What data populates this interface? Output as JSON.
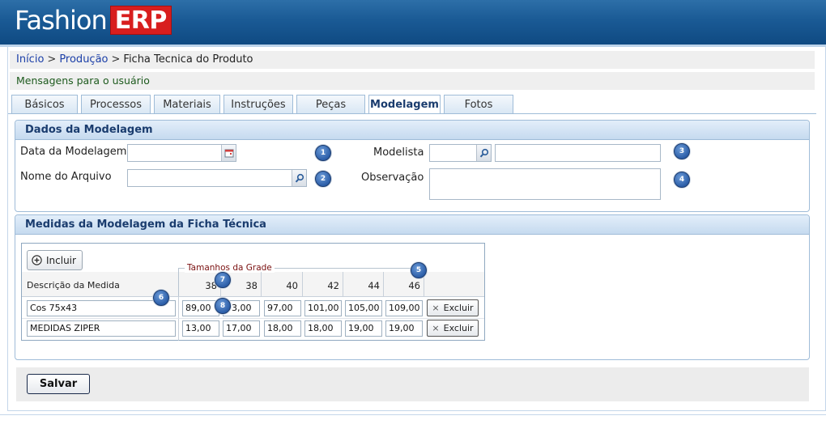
{
  "app": {
    "logo_text": "Fashion",
    "logo_badge": "ERP"
  },
  "breadcrumb": {
    "home": "Início",
    "section": "Produção",
    "current": "Ficha Tecnica do Produto",
    "separator": ">"
  },
  "messages": "Mensagens para o usuário",
  "tabs": [
    {
      "label": "Básicos"
    },
    {
      "label": "Processos"
    },
    {
      "label": "Materiais"
    },
    {
      "label": "Instruções"
    },
    {
      "label": "Peças"
    },
    {
      "label": "Modelagem"
    },
    {
      "label": "Fotos"
    }
  ],
  "active_tab": "Modelagem",
  "dados": {
    "title": "Dados da Modelagem",
    "data_label": "Data da Modelagem",
    "data_value": "",
    "arquivo_label": "Nome do Arquivo",
    "arquivo_value": "",
    "modelista_label": "Modelista",
    "modelista_code": "",
    "modelista_name": "",
    "observacao_label": "Observação",
    "observacao_value": ""
  },
  "medidas": {
    "title": "Medidas da Modelagem da Ficha Técnica",
    "incluir_label": "Incluir",
    "grade_label": "Tamanhos da Grade",
    "descricao_header": "Descrição da Medida",
    "sizes": [
      "38",
      "38",
      "40",
      "42",
      "44",
      "46"
    ],
    "rows": [
      {
        "descricao": "Cos 75x43",
        "values": [
          "89,00",
          "93,00",
          "97,00",
          "101,00",
          "105,00",
          "109,00"
        ],
        "excluir": "Excluir"
      },
      {
        "descricao": "MEDIDAS ZIPER",
        "values": [
          "13,00",
          "17,00",
          "18,00",
          "18,00",
          "19,00",
          "19,00"
        ],
        "excluir": "Excluir"
      }
    ]
  },
  "markers": [
    "1",
    "2",
    "3",
    "4",
    "5",
    "6",
    "7",
    "8"
  ],
  "save_label": "Salvar",
  "colors": {
    "header": "#1a5a95",
    "logo_badge": "#d81e1e",
    "panel_title": "#1a3c6e",
    "link": "#1b3fa8",
    "marker": "#2c5ea8"
  }
}
